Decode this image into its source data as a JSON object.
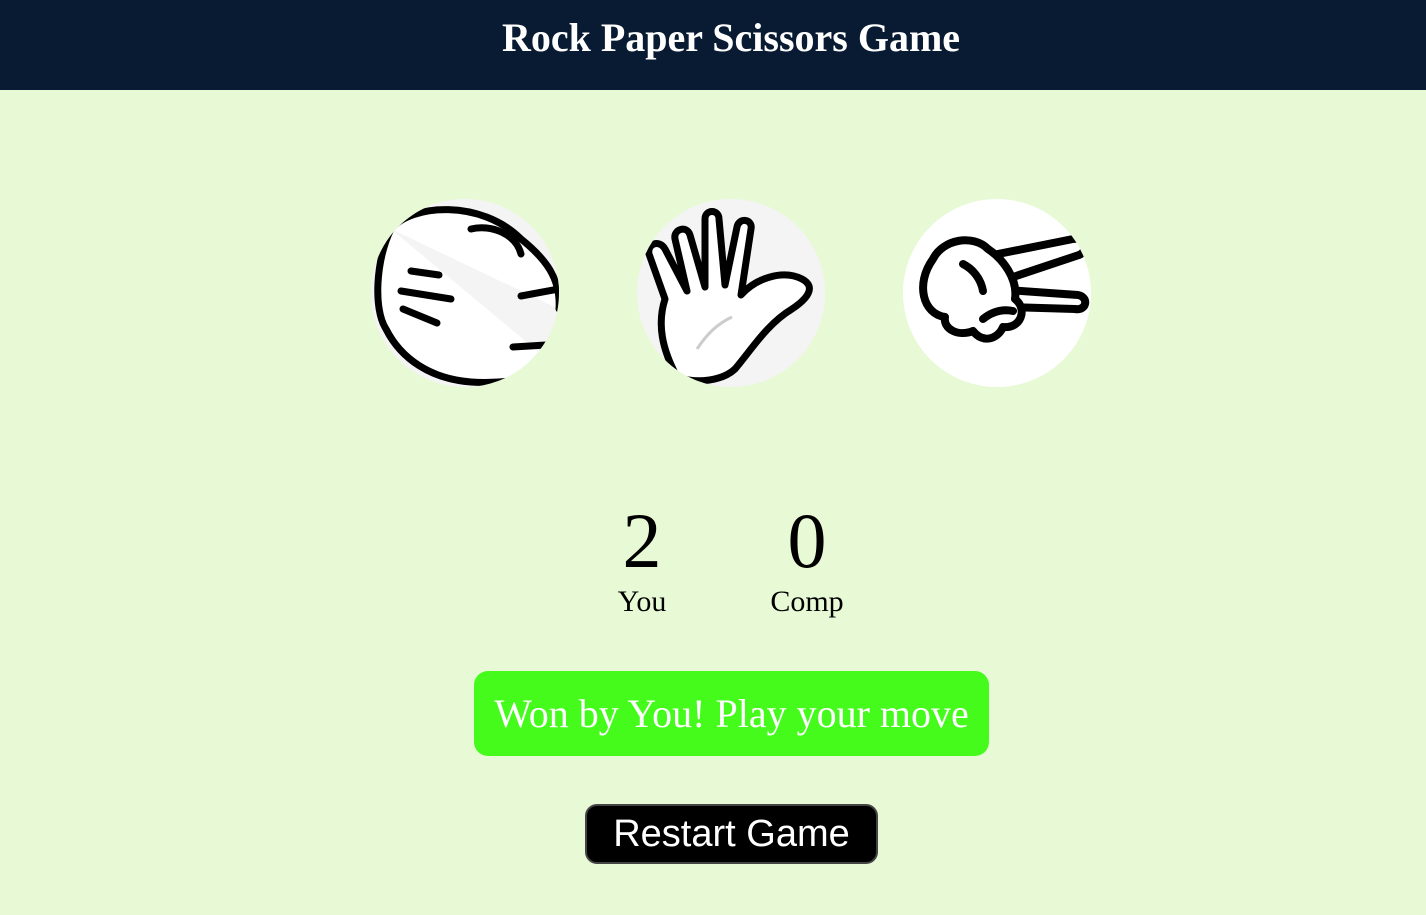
{
  "header": {
    "title": "Rock Paper Scissors Game"
  },
  "choices": [
    {
      "id": "rock",
      "icon": "rock-fist-icon"
    },
    {
      "id": "paper",
      "icon": "paper-hand-icon"
    },
    {
      "id": "scissors",
      "icon": "scissors-hand-icon"
    }
  ],
  "scoreboard": {
    "user": {
      "score": "2",
      "label": "You"
    },
    "comp": {
      "score": "0",
      "label": "Comp"
    }
  },
  "message": {
    "text": "Won by You! Play your move",
    "color": "#44fb1c"
  },
  "restart": {
    "label": "Restart Game"
  },
  "colors": {
    "header_bg": "#081b33",
    "page_bg": "#e8f9d6"
  }
}
